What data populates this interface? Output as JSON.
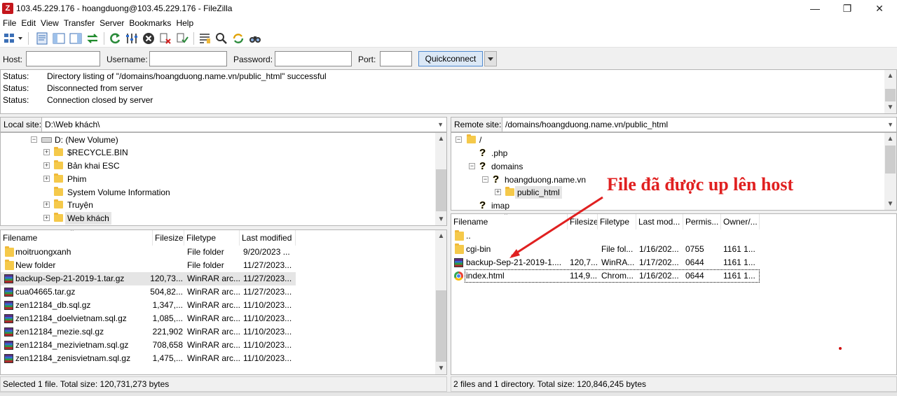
{
  "window": {
    "title": "103.45.229.176 - hoangduong@103.45.229.176 - FileZilla",
    "app_icon_letter": "Z"
  },
  "menu": [
    "File",
    "Edit",
    "View",
    "Transfer",
    "Server",
    "Bookmarks",
    "Help"
  ],
  "quickconnect": {
    "host_label": "Host:",
    "username_label": "Username:",
    "password_label": "Password:",
    "port_label": "Port:",
    "button_label": "Quickconnect",
    "host_value": "",
    "username_value": "",
    "password_value": "",
    "port_value": ""
  },
  "log": [
    {
      "key": "Status:",
      "text": "Directory listing of \"/domains/hoangduong.name.vn/public_html\" successful"
    },
    {
      "key": "Status:",
      "text": "Disconnected from server"
    },
    {
      "key": "Status:",
      "text": "Connection closed by server"
    }
  ],
  "local": {
    "site_label": "Local site:",
    "path": "D:\\Web khách\\",
    "tree": [
      {
        "label": "D: (New Volume)",
        "type": "drive"
      },
      {
        "label": "$RECYCLE.BIN",
        "type": "folder"
      },
      {
        "label": "Bản khai ESC",
        "type": "folder"
      },
      {
        "label": "Phim",
        "type": "folder"
      },
      {
        "label": "System Volume Information",
        "type": "folder"
      },
      {
        "label": "Truyện",
        "type": "folder"
      },
      {
        "label": "Web khách",
        "type": "folder"
      }
    ],
    "columns": [
      "Filename",
      "Filesize",
      "Filetype",
      "Last modified"
    ],
    "files": [
      {
        "name": "moitruongxanh",
        "size": "",
        "type": "File folder",
        "modified": "9/20/2023 ...",
        "icon": "folder"
      },
      {
        "name": "New folder",
        "size": "",
        "type": "File folder",
        "modified": "11/27/2023...",
        "icon": "folder"
      },
      {
        "name": "backup-Sep-21-2019-1.tar.gz",
        "size": "120,73...",
        "type": "WinRAR arc...",
        "modified": "11/27/2023...",
        "icon": "rar"
      },
      {
        "name": "cua04665.tar.gz",
        "size": "504,82...",
        "type": "WinRAR arc...",
        "modified": "11/27/2023...",
        "icon": "rar"
      },
      {
        "name": "zen12184_db.sql.gz",
        "size": "1,347,...",
        "type": "WinRAR arc...",
        "modified": "11/10/2023...",
        "icon": "rar"
      },
      {
        "name": "zen12184_doelvietnam.sql.gz",
        "size": "1,085,...",
        "type": "WinRAR arc...",
        "modified": "11/10/2023...",
        "icon": "rar"
      },
      {
        "name": "zen12184_mezie.sql.gz",
        "size": "221,902",
        "type": "WinRAR arc...",
        "modified": "11/10/2023...",
        "icon": "rar"
      },
      {
        "name": "zen12184_mezivietnam.sql.gz",
        "size": "708,658",
        "type": "WinRAR arc...",
        "modified": "11/10/2023...",
        "icon": "rar"
      },
      {
        "name": "zen12184_zenisvietnam.sql.gz",
        "size": "1,475,...",
        "type": "WinRAR arc...",
        "modified": "11/10/2023...",
        "icon": "rar"
      }
    ],
    "status": "Selected 1 file. Total size: 120,731,273 bytes"
  },
  "remote": {
    "site_label": "Remote site:",
    "path": "/domains/hoangduong.name.vn/public_html",
    "tree": [
      {
        "label": "/",
        "type": "folder"
      },
      {
        "label": ".php",
        "type": "unknown"
      },
      {
        "label": "domains",
        "type": "unknown"
      },
      {
        "label": "hoangduong.name.vn",
        "type": "unknown"
      },
      {
        "label": "public_html",
        "type": "folder"
      },
      {
        "label": "imap",
        "type": "unknown"
      }
    ],
    "columns": [
      "Filename",
      "Filesize",
      "Filetype",
      "Last mod...",
      "Permis...",
      "Owner/..."
    ],
    "files": [
      {
        "name": "..",
        "size": "",
        "type": "",
        "modified": "",
        "perms": "",
        "owner": "",
        "icon": "folder"
      },
      {
        "name": "cgi-bin",
        "size": "",
        "type": "File fol...",
        "modified": "1/16/202...",
        "perms": "0755",
        "owner": "1161 1...",
        "icon": "folder"
      },
      {
        "name": "backup-Sep-21-2019-1....",
        "size": "120,7...",
        "type": "WinRA...",
        "modified": "1/17/202...",
        "perms": "0644",
        "owner": "1161 1...",
        "icon": "rar"
      },
      {
        "name": "index.html",
        "size": "114,9...",
        "type": "Chrom...",
        "modified": "1/16/202...",
        "perms": "0644",
        "owner": "1161 1...",
        "icon": "chrome"
      }
    ],
    "status": "2 files and 1 directory. Total size: 120,846,245 bytes"
  },
  "annotation": {
    "text": "File đã được up lên host",
    "color": "#e02020"
  }
}
